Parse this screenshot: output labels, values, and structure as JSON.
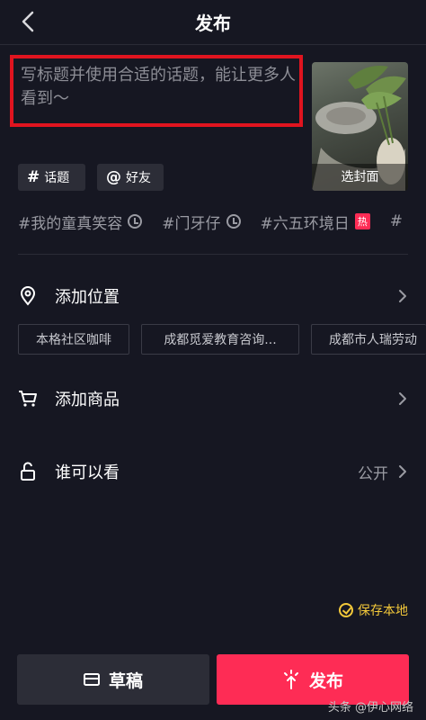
{
  "header": {
    "title": "发布",
    "back_icon": "chevron-left-icon"
  },
  "caption": {
    "placeholder": "写标题并使用合适的话题，能让更多人看到～",
    "highlight_color": "#e0141f"
  },
  "cover": {
    "label": "选封面"
  },
  "chips": {
    "topic_icon": "#",
    "topic_label": "话题",
    "friend_icon": "@",
    "friend_label": "好友"
  },
  "trending_tags": [
    {
      "text": "#我的童真笑容",
      "marker": "clock-icon"
    },
    {
      "text": "#门牙仔",
      "marker": "clock-icon"
    },
    {
      "text": "#六五环境日",
      "marker": "热"
    },
    {
      "text": "#"
    }
  ],
  "location": {
    "label": "添加位置",
    "suggestions": [
      "本格社区咖啡",
      "成都觅爱教育咨询...",
      "成都市人瑞劳动"
    ]
  },
  "products": {
    "label": "添加商品"
  },
  "visibility": {
    "label": "谁可以看",
    "value": "公开"
  },
  "save_local": {
    "label": "保存本地",
    "color": "#f4c93a"
  },
  "actions": {
    "draft_label": "草稿",
    "publish_label": "发布",
    "publish_color": "#fe2c55"
  },
  "watermark": {
    "text": "头条 @伊心网络"
  }
}
